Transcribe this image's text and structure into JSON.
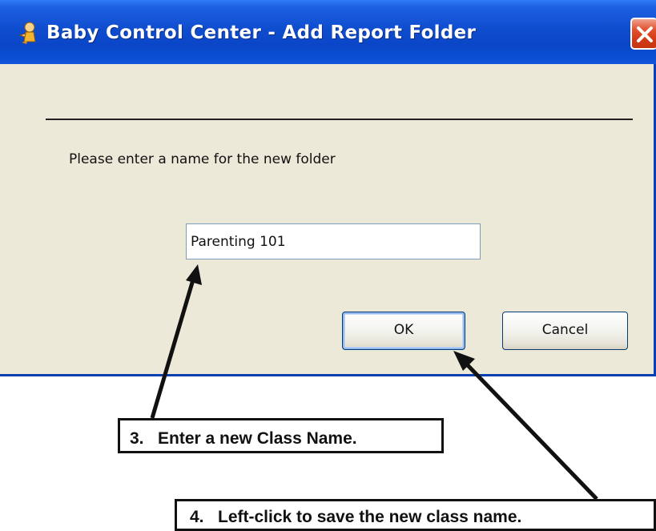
{
  "window": {
    "title": "Baby Control Center - Add Report Folder",
    "app_icon": "baby-app-icon",
    "close_icon": "close-icon",
    "close_color": "#d23a16",
    "titlebar_color": "#0a46c7",
    "body_color": "#ece9d8"
  },
  "dialog": {
    "prompt": "Please enter a name for the new folder",
    "folder_name_value": "Parenting 101",
    "ok_label": "OK",
    "cancel_label": "Cancel"
  },
  "annotations": {
    "step3_label": "3.   Enter a new Class Name.",
    "step4_label": "4.   Left-click to save the new class name."
  }
}
